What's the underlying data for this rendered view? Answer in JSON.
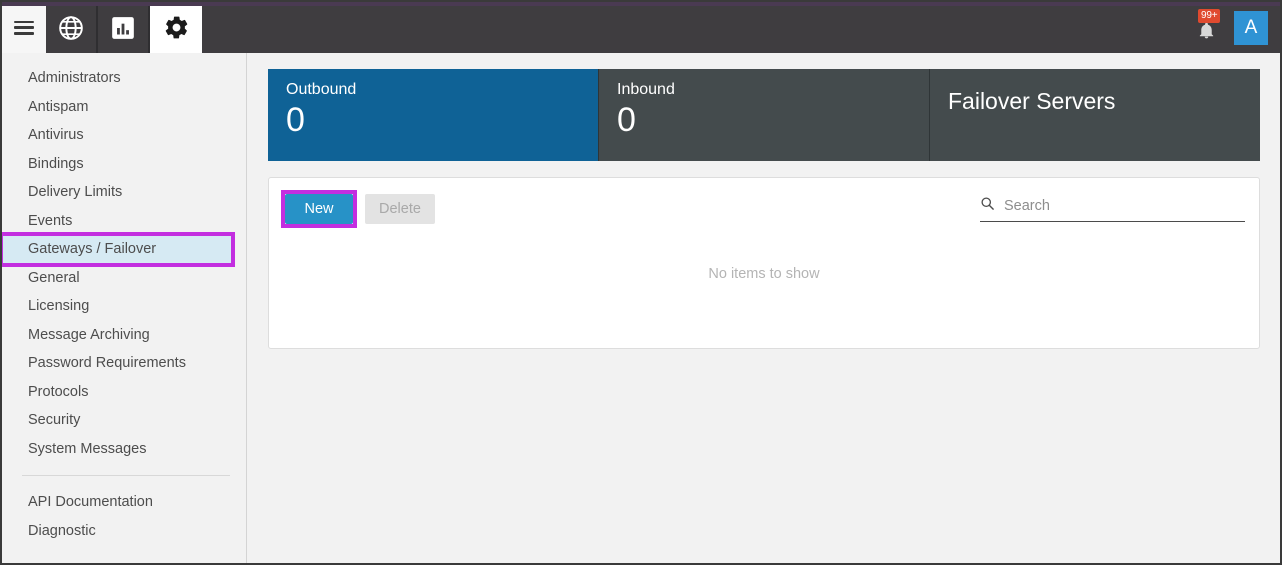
{
  "topbar": {
    "menu_icon": "hamburger-icon",
    "tabs": [
      {
        "icon": "globe-icon",
        "name": "globe",
        "active": false
      },
      {
        "icon": "bar-chart-icon",
        "name": "reports",
        "active": false
      },
      {
        "icon": "gear-icon",
        "name": "settings",
        "active": true
      }
    ],
    "notification": {
      "icon": "bell-icon",
      "badge": "99+",
      "badge_color": "#e04a2f"
    },
    "avatar": {
      "initial": "A",
      "color": "#2f93d4"
    },
    "accent_color": "#4a3a52",
    "background_color": "#3f3d40"
  },
  "sidebar": {
    "items": [
      {
        "label": "Administrators",
        "selected": false
      },
      {
        "label": "Antispam",
        "selected": false
      },
      {
        "label": "Antivirus",
        "selected": false
      },
      {
        "label": "Bindings",
        "selected": false
      },
      {
        "label": "Delivery Limits",
        "selected": false
      },
      {
        "label": "Events",
        "selected": false
      },
      {
        "label": "Gateways / Failover",
        "selected": true
      },
      {
        "label": "General",
        "selected": false
      },
      {
        "label": "Licensing",
        "selected": false
      },
      {
        "label": "Message Archiving",
        "selected": false
      },
      {
        "label": "Password Requirements",
        "selected": false
      },
      {
        "label": "Protocols",
        "selected": false
      },
      {
        "label": "Security",
        "selected": false
      },
      {
        "label": "System Messages",
        "selected": false
      }
    ],
    "footer_items": [
      {
        "label": "API Documentation"
      },
      {
        "label": "Diagnostic"
      }
    ],
    "selected_background": "#d6eaf3",
    "highlight_color": "#c32ee0"
  },
  "main": {
    "tiles": [
      {
        "label": "Outbound",
        "value": "0",
        "style": "blue",
        "color": "#0f6296"
      },
      {
        "label": "Inbound",
        "value": "0",
        "style": "dark",
        "color": "#444b4d"
      },
      {
        "label": "Failover Servers",
        "value": "",
        "style": "dark-title",
        "color": "#444b4d"
      }
    ],
    "toolbar": {
      "new_label": "New",
      "delete_label": "Delete",
      "new_color": "#2792c7",
      "new_highlight": "#c32ee0"
    },
    "search": {
      "placeholder": "Search",
      "value": "",
      "icon": "search-icon"
    },
    "empty_message": "No items to show"
  }
}
